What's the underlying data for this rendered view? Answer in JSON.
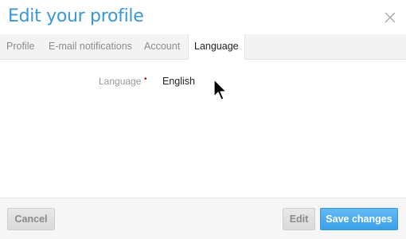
{
  "dialog": {
    "title": "Edit your profile"
  },
  "tabs": [
    {
      "label": "Profile",
      "active": false
    },
    {
      "label": "E-mail notifications",
      "active": false
    },
    {
      "label": "Account",
      "active": false
    },
    {
      "label": "Language",
      "active": true
    }
  ],
  "form": {
    "language_label": "Language",
    "required_marker": "•",
    "language_value": "English"
  },
  "footer": {
    "cancel_label": "Cancel",
    "edit_label": "Edit",
    "save_label": "Save changes"
  },
  "colors": {
    "accent": "#3a97d8",
    "save_button": "#4aa9ee",
    "required": "#c00000"
  },
  "icons": {
    "close": "close-icon",
    "cursor": "mouse-pointer-icon"
  }
}
